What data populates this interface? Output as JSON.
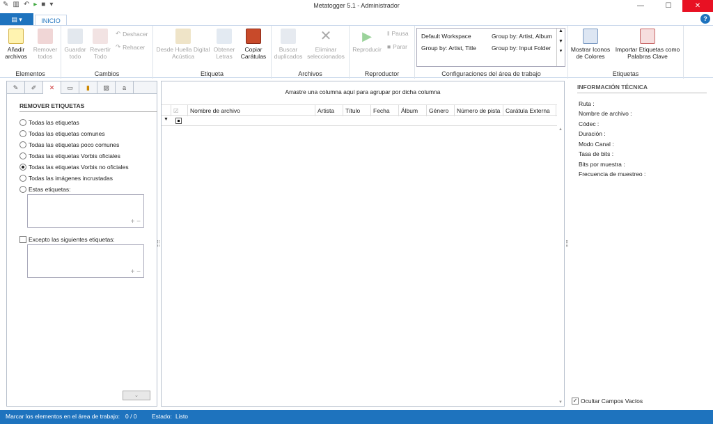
{
  "window": {
    "title": "Metatogger 5.1 - Administrador"
  },
  "tabs": {
    "file_label": "▤ ▾",
    "active": "INICIO"
  },
  "ribbon": {
    "elementos": {
      "label": "Elementos",
      "add_files": "Añadir archivos",
      "remove_all": "Remover todos"
    },
    "cambios": {
      "label": "Cambios",
      "save_all": "Guardar todo",
      "revert_all": "Revertir Todo",
      "undo": "Deshacer",
      "redo": "Rehacer"
    },
    "etiqueta": {
      "label": "Etiqueta",
      "acoustic": "Desde Huella Digital Acústica",
      "lyrics": "Obtener Letras",
      "covers": "Copiar Carátulas"
    },
    "archivos": {
      "label": "Archivos",
      "find_dupes": "Buscar duplicados",
      "delete_selected": "Eliminar seleccionados"
    },
    "reproductor": {
      "label": "Reproductor",
      "play": "Reproducir",
      "pause": "Pausa",
      "stop": "Parar"
    },
    "workspace": {
      "label": "Configuraciones del área de trabajo",
      "items": [
        "Default Workspace",
        "Group by: Artist, Album",
        "Group by: Artist, Title",
        "Group by: Input Folder"
      ]
    },
    "etiquetas": {
      "label": "Etiquetas",
      "show_icons": "Mostrar Iconos de Colores",
      "import_tags": "Importar Etiquetas como Palabras Clave"
    }
  },
  "left": {
    "header": "REMOVER ETIQUETAS",
    "options": [
      "Todas las etiquetas",
      "Todas las etiquetas comunes",
      "Todas las etiquetas poco comunes",
      "Todas las etiquetas Vorbis oficiales",
      "Todas las etiquetas Vorbis no oficiales",
      "Todas las imágenes incrustadas",
      "Estas etiquetas:"
    ],
    "selected_option": 4,
    "except_label": "Excepto las siguientes etiquetas:"
  },
  "grid": {
    "group_hint": "Arrastre una columna aquí para agrupar por dicha columna",
    "columns": [
      "Nombre de archivo",
      "Artista",
      "Título",
      "Fecha",
      "Álbum",
      "Género",
      "Número de pista",
      "Carátula Externa"
    ]
  },
  "right": {
    "header": "INFORMACIÓN TÉCNICA",
    "fields": [
      "Ruta :",
      "Nombre de archivo :",
      "Códec :",
      "Duración :",
      "Modo Canal :",
      "Tasa de bits :",
      "Bits por muestra :",
      "Frecuencia de muestreo :"
    ],
    "hide_empty": "Ocultar Campos Vacíos"
  },
  "status": {
    "mark": "Marcar los elementos en el área de trabajo:",
    "count": "0 / 0",
    "state": "Estado:",
    "state_value": "Listo"
  },
  "colors": {
    "accent": "#1e73be",
    "close": "#e81123"
  }
}
